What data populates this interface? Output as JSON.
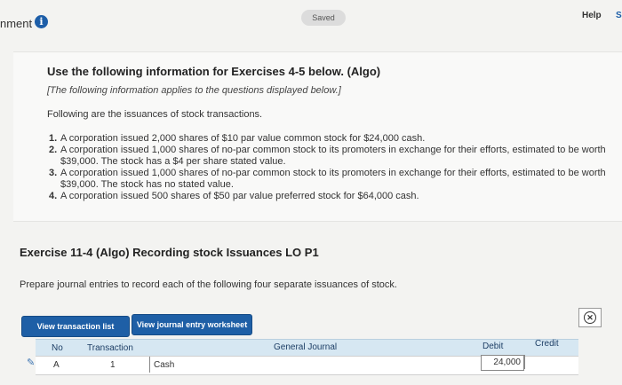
{
  "header": {
    "assignment_label": "nment",
    "info_icon": "info-icon",
    "saved_label": "Saved",
    "help_label": "Help",
    "next_edge_label": "S"
  },
  "info": {
    "title": "Use the following information for Exercises 4-5 below. (Algo)",
    "subtitle": "[The following information applies to the questions displayed below.]",
    "intro": "Following are the issuances of stock transactions.",
    "items": [
      {
        "num": "1.",
        "text": "A corporation issued 2,000 shares of $10 par value common stock for $24,000 cash."
      },
      {
        "num": "2.",
        "text": "A corporation issued 1,000 shares of no-par common stock to its promoters in exchange for their efforts, estimated to be worth $39,000. The stock has a $4 per share stated value."
      },
      {
        "num": "3.",
        "text": "A corporation issued 1,000 shares of no-par common stock to its promoters in exchange for their efforts, estimated to be worth $39,000. The stock has no stated value."
      },
      {
        "num": "4.",
        "text": "A corporation issued 500 shares of $50 par value preferred stock for $64,000 cash."
      }
    ]
  },
  "exercise": {
    "title": "Exercise 11-4 (Algo) Recording stock Issuances LO P1",
    "prompt": "Prepare journal entries to record each of the following four separate issuances of stock."
  },
  "buttons": {
    "view_transaction_list": "View transaction list",
    "view_journal_entry_worksheet": "View journal entry worksheet",
    "close_icon": "close-circle-icon"
  },
  "journal": {
    "headers": {
      "no": "No",
      "transaction": "Transaction",
      "general_journal": "General Journal",
      "debit": "Debit",
      "credit": "Credit"
    },
    "rows": [
      {
        "edit_icon": "pencil-icon",
        "no": "A",
        "transaction": "1",
        "account": "Cash",
        "debit": "24,000",
        "credit": ""
      }
    ]
  },
  "colors": {
    "accent": "#1e5fa6",
    "table_header_bg": "#d6e7f2"
  }
}
